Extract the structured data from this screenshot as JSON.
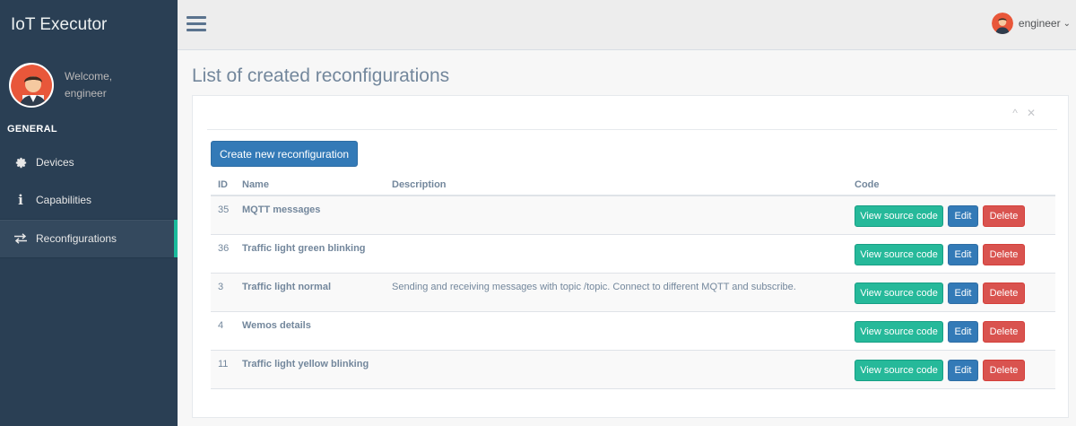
{
  "app": {
    "title": "IoT Executor"
  },
  "profile": {
    "welcome": "Welcome,",
    "username": "engineer"
  },
  "sidebar": {
    "section": "GENERAL",
    "items": [
      {
        "label": "Devices",
        "icon": "gear-icon"
      },
      {
        "label": "Capabilities",
        "icon": "info-icon"
      },
      {
        "label": "Reconfigurations",
        "icon": "exchange-icon",
        "active": true
      }
    ]
  },
  "topbar": {
    "username": "engineer",
    "caret": "⌄"
  },
  "page": {
    "title": "List of created reconfigurations"
  },
  "panel": {
    "collapse": "^",
    "close": "✕"
  },
  "actions": {
    "create": "Create new reconfiguration"
  },
  "table": {
    "headers": {
      "id": "ID",
      "name": "Name",
      "description": "Description",
      "code": "Code"
    },
    "rows": [
      {
        "id": "35",
        "name": "MQTT messages",
        "description": ""
      },
      {
        "id": "36",
        "name": "Traffic light green blinking",
        "description": ""
      },
      {
        "id": "3",
        "name": "Traffic light normal",
        "description": "Sending and receiving messages with topic /topic. Connect to different MQTT and subscribe."
      },
      {
        "id": "4",
        "name": "Wemos details",
        "description": ""
      },
      {
        "id": "11",
        "name": "Traffic light yellow blinking",
        "description": ""
      }
    ],
    "buttons": {
      "view": "View source code",
      "edit": "Edit",
      "delete": "Delete"
    }
  },
  "colors": {
    "sidebar": "#2a3f54",
    "accent": "#1abb9c",
    "primary": "#337ab7",
    "success": "#26b99a",
    "danger": "#d9534f"
  }
}
